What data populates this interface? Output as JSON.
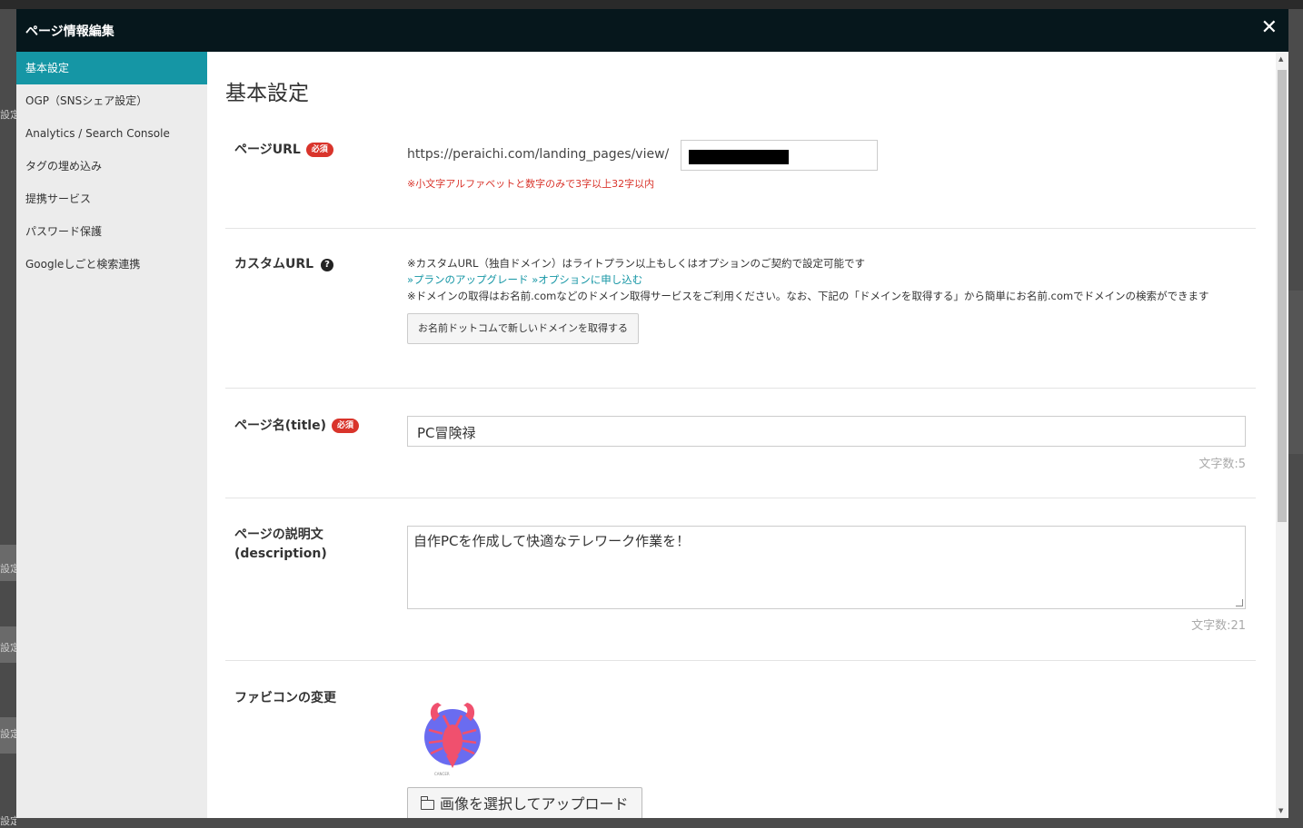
{
  "modal": {
    "title": "ページ情報編集",
    "close_label": "✕"
  },
  "background": {
    "ghost_text": "設定"
  },
  "sidebar": {
    "items": [
      {
        "label": "基本設定",
        "active": true
      },
      {
        "label": "OGP（SNSシェア設定）"
      },
      {
        "label": "Analytics / Search Console"
      },
      {
        "label": "タグの埋め込み"
      },
      {
        "label": "提携サービス"
      },
      {
        "label": "パスワード保護"
      },
      {
        "label": "Googleしごと検索連携"
      }
    ]
  },
  "main": {
    "section_title": "基本設定",
    "required_badge": "必須",
    "page_url": {
      "label": "ページURL",
      "prefix": "https://peraichi.com/landing_pages/view/",
      "hint": "※小文字アルファベットと数字のみで3字以上32字以内"
    },
    "custom_url": {
      "label": "カスタムURL",
      "help_icon": "?",
      "note1": "※カスタムURL（独自ドメイン）はライトプラン以上もしくはオプションのご契約で設定可能です",
      "link_upgrade": "»プランのアップグレード",
      "link_option": "»オプションに申し込む",
      "note2": "※ドメインの取得はお名前.comなどのドメイン取得サービスをご利用ください。なお、下記の「ドメインを取得する」から簡単にお名前.comでドメインの検索ができます",
      "button": "お名前ドットコムで新しいドメインを取得する"
    },
    "page_title": {
      "label": "ページ名(title)",
      "value": "PC冒険禄",
      "count": "文字数:5"
    },
    "description": {
      "label_line1": "ページの説明文",
      "label_line2": "(description)",
      "value": "自作PCを作成して快適なテレワーク作業を！",
      "count": "文字数:21"
    },
    "favicon": {
      "label": "ファビコンの変更",
      "image_caption": "CANCER",
      "upload_button": "画像を選択してアップロード"
    }
  },
  "colors": {
    "header_bg": "#06171c",
    "active_tab": "#1596a5",
    "required_badge": "#d9342b",
    "link": "#1596a5",
    "hint": "#d9342b"
  }
}
